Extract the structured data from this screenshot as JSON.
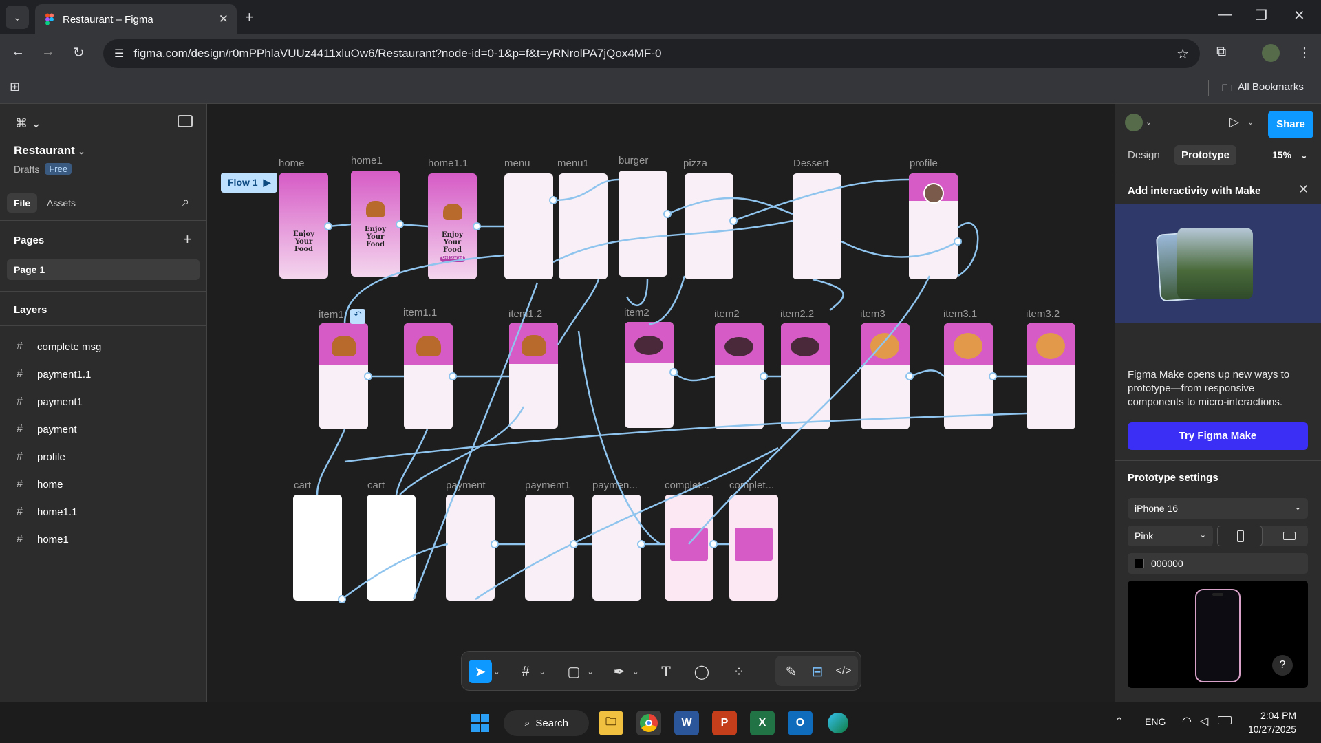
{
  "browser": {
    "tab_title": "Restaurant – Figma",
    "url": "figma.com/design/r0mPPhlaVUUz4411xluOw6/Restaurant?node-id=0-1&p=f&t=yRNrolPA7jQox4MF-0",
    "bookmarks_label": "All Bookmarks"
  },
  "figma": {
    "file_name": "Restaurant",
    "drafts": "Drafts",
    "plan_badge": "Free",
    "tab_file": "File",
    "tab_assets": "Assets",
    "pages_title": "Pages",
    "page1": "Page 1",
    "layers_title": "Layers",
    "layers": [
      "complete msg",
      "payment1.1",
      "payment1",
      "payment",
      "profile",
      "home",
      "home1.1",
      "home1"
    ],
    "flow_label": "Flow 1"
  },
  "canvas": {
    "row1": [
      "home",
      "home1",
      "home1.1",
      "menu",
      "menu1",
      "burger",
      "pizza",
      "Dessert",
      "profile"
    ],
    "row2": [
      "item1",
      "item1.1",
      "item1.2",
      "item2",
      "item2",
      "item2.2",
      "item3",
      "item3.1",
      "item3.2"
    ],
    "row3": [
      "cart",
      "cart",
      "payment",
      "payment1",
      "paymen...",
      "complet...",
      "complet..."
    ],
    "home_text": "Enjoy Your Food",
    "get_started": "Get Started"
  },
  "right_panel": {
    "tab_design": "Design",
    "tab_prototype": "Prototype",
    "zoom": "15%",
    "share": "Share",
    "make_title": "Add interactivity with Make",
    "make_desc": "Figma Make opens up new ways to prototype—from responsive components to micro-interactions.",
    "make_button": "Try Figma Make",
    "proto_settings": "Prototype settings",
    "device": "iPhone 16",
    "color_model": "Pink",
    "bg_color": "000000",
    "help": "?"
  },
  "taskbar": {
    "search": "Search",
    "lang": "ENG",
    "time": "2:04 PM",
    "date": "10/27/2025"
  },
  "colors": {
    "accent": "#0d99ff",
    "make_button": "#3b2ef5",
    "frame_pink": "#d65bc6"
  }
}
